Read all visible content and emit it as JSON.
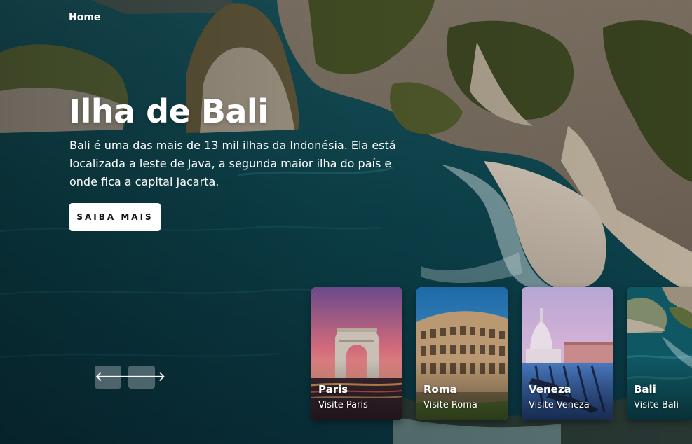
{
  "nav": {
    "home_label": "Home"
  },
  "hero": {
    "title": "Ilha de Bali",
    "description": "Bali é uma das mais de 13 mil ilhas da Indonésia. Ela está localizada a leste de Java, a segunda maior ilha do país e onde fica a capital Jacarta.",
    "cta_label": "SAIBA MAIS"
  },
  "controls": {
    "prev_icon": "arrow-left-icon",
    "next_icon": "arrow-right-icon",
    "prev_glyph": "🡐",
    "next_glyph": "🡒"
  },
  "cards": [
    {
      "title": "Paris",
      "subtitle": "Visite Paris"
    },
    {
      "title": "Roma",
      "subtitle": "Visite Roma"
    },
    {
      "title": "Veneza",
      "subtitle": "Visite Veneza"
    },
    {
      "title": "Bali",
      "subtitle": "Visite Bali"
    }
  ],
  "colors": {
    "sea": "#0c4a55",
    "cliff": "#a89c88",
    "vegetation": "#3e4a22",
    "sand": "#d9cfc2",
    "button_bg": "#ffffff"
  }
}
